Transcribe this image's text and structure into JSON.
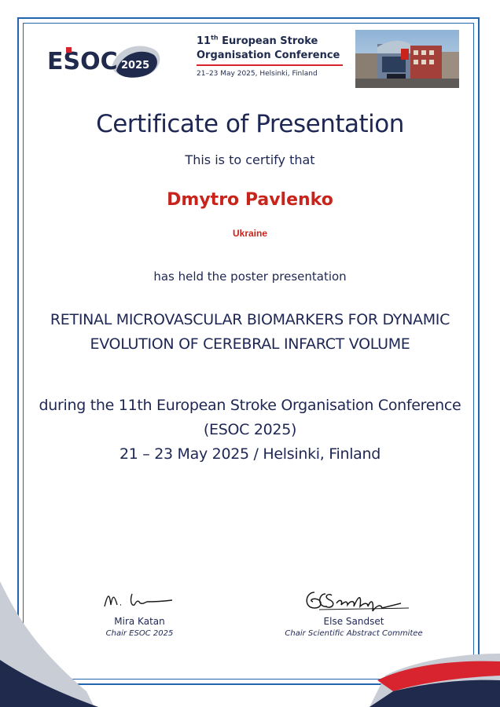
{
  "header": {
    "logo": {
      "text": "ESOC",
      "badge": "2025"
    },
    "conference": {
      "line1_sup": "11",
      "line1_sup_suffix": "th",
      "line1_rest": " European Stroke",
      "line2": "Organisation Conference",
      "dates": "21–23 May 2025, Helsinki, Finland"
    },
    "photo_icon": "conference-venue-photo"
  },
  "certificate": {
    "title": "Certificate of Presentation",
    "certify_text": "This is to certify that",
    "recipient_name": "Dmytro Pavlenko",
    "country": "Ukraine",
    "held_text": "has held the poster presentation",
    "presentation_title_line1": "RETINAL MICROVASCULAR BIOMARKERS FOR DYNAMIC",
    "presentation_title_line2": "EVOLUTION OF CEREBRAL INFARCT VOLUME",
    "during_line1": "during the 11th European Stroke Organisation Conference",
    "during_line2": "(ESOC 2025)",
    "during_line3": "21 – 23 May 2025 / Helsinki, Finland"
  },
  "signatures": [
    {
      "name": "Mira Katan",
      "role": "Chair ESOC 2025",
      "signature": "M. Kat"
    },
    {
      "name": "Else Sandset",
      "role": "Chair Scientific Abstract Commitee",
      "signature": "ECSandset"
    }
  ],
  "colors": {
    "frame": "#2466ad",
    "navy": "#1e2754",
    "red": "#c8241c",
    "brand_red": "#d7242f"
  }
}
